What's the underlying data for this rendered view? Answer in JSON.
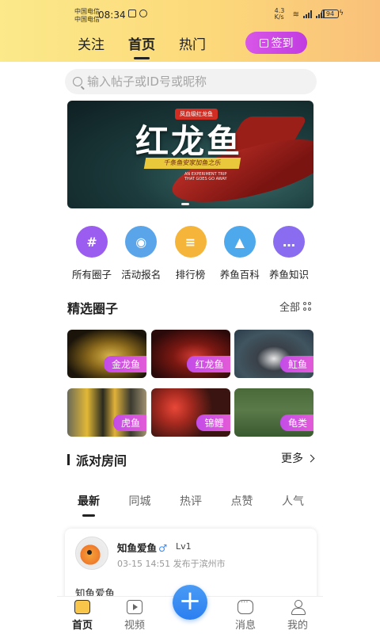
{
  "status_bar": {
    "carrier1": "中国电信",
    "carrier2": "中国电信",
    "time": "08:34",
    "speed": "4.3 K/s",
    "battery": "94"
  },
  "header": {
    "tabs": [
      {
        "label": "关注"
      },
      {
        "label": "首页"
      },
      {
        "label": "热门"
      }
    ],
    "checkin_label": "签到"
  },
  "search": {
    "placeholder": "输入帖子或ID号或昵称"
  },
  "banner": {
    "tag": "凤血级红龙鱼",
    "title": "红龙鱼",
    "ribbon": "千条鱼安家加鱼之乐",
    "subtitle": "AN EXPERIMENT TRIP THAT GOES GO AWAY"
  },
  "quick_menu": [
    {
      "label": "所有圈子",
      "icon": "hashtag-icon",
      "color": "#9b5cf0",
      "glyph": "#"
    },
    {
      "label": "活动报名",
      "icon": "activity-icon",
      "color": "#5aa5ea",
      "glyph": "◉"
    },
    {
      "label": "排行榜",
      "icon": "ranking-icon",
      "color": "#f5b43a",
      "glyph": "≡"
    },
    {
      "label": "养鱼百科",
      "icon": "graduation-cap-icon",
      "color": "#4ea8ec",
      "glyph": "▲"
    },
    {
      "label": "养鱼知识",
      "icon": "chat-icon",
      "color": "#8a6cf0",
      "glyph": "…"
    }
  ],
  "featured": {
    "title": "精选圈子",
    "all_label": "全部",
    "circles": [
      {
        "label": "金龙鱼"
      },
      {
        "label": "红龙鱼"
      },
      {
        "label": "魟鱼"
      },
      {
        "label": "虎鱼"
      },
      {
        "label": "锦鲤"
      },
      {
        "label": "龟类"
      }
    ]
  },
  "party": {
    "title": "派对房间",
    "more_label": "更多"
  },
  "feed_tabs": [
    {
      "label": "最新"
    },
    {
      "label": "同城"
    },
    {
      "label": "热评"
    },
    {
      "label": "点赞"
    },
    {
      "label": "人气"
    }
  ],
  "post": {
    "username": "知鱼爱鱼",
    "gender": "♂",
    "level": "Lv1",
    "meta": "03-15 14:51  发布于滨州市",
    "text": "知鱼爱鱼"
  },
  "bottom_nav": [
    {
      "label": "首页"
    },
    {
      "label": "视频"
    },
    {
      "label": "消息"
    },
    {
      "label": "我的"
    }
  ],
  "fab_label": "+"
}
